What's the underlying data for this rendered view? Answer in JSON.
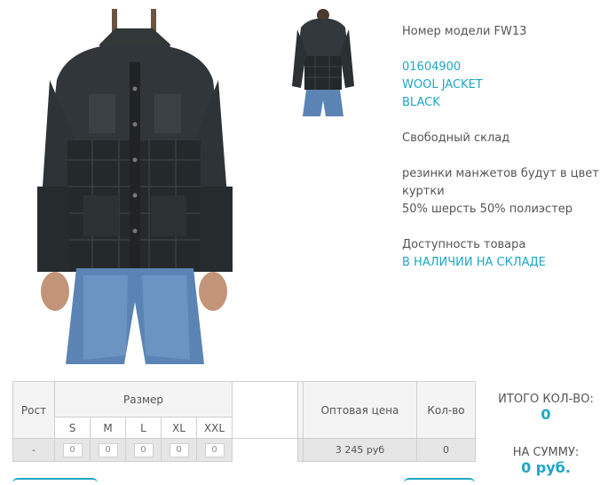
{
  "product": {
    "model_label": "Номер модели FW13",
    "code": "01604900",
    "name_line1": "WOOL JACKET",
    "name_line2": "BLACK",
    "stock_type": "Свободный склад",
    "desc_line1": "резинки манжетов будут в цвет",
    "desc_line2": "куртки",
    "composition": "50% шерсть 50% полиэстер",
    "availability_label": "Доступность товара",
    "availability_value": "В НАЛИЧИИ НА СКЛАДЕ"
  },
  "table": {
    "height_header": "Рост",
    "size_header": "Размер",
    "sizes": [
      "S",
      "M",
      "L",
      "XL",
      "XXL"
    ],
    "price_header": "Оптовая цена",
    "qty_header": "Кол-во",
    "row": {
      "height": "-",
      "qtys": [
        "0",
        "0",
        "0",
        "0",
        "0"
      ],
      "price": "3 245 руб",
      "qty": "0"
    }
  },
  "totals": {
    "count_label": "ИТОГО КОЛ-ВО:",
    "count_value": "0",
    "sum_label": "НА СУММУ:",
    "sum_value": "0 руб."
  },
  "colors": {
    "accent": "#1da7c4",
    "jacket": "#2a2e2f",
    "jeans": "#5b84b4"
  }
}
